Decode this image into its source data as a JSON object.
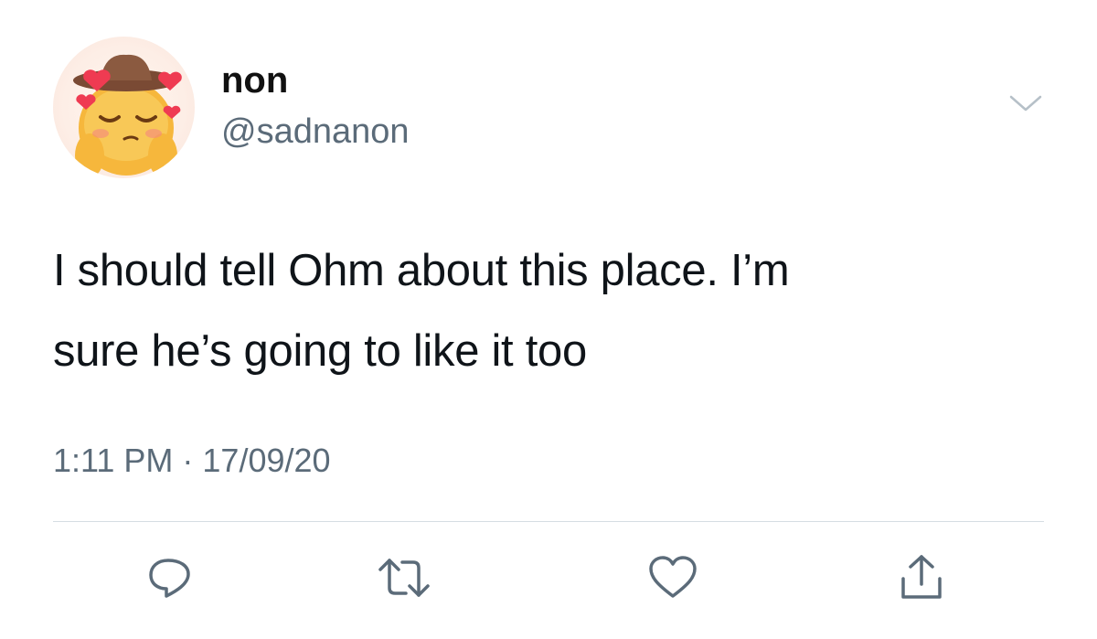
{
  "author": {
    "display_name": "non",
    "handle": "@sadnanon",
    "avatar_icon": "blushing-face-with-hearts-icon"
  },
  "tweet": {
    "text_line1": "I should tell Ohm about this place. I’m",
    "text_line2": "sure he’s going to like it too",
    "time": "1:11 PM",
    "separator": "·",
    "date": "17/09/20"
  },
  "actions": [
    {
      "name": "reply",
      "icon": "reply-bubble-icon"
    },
    {
      "name": "retweet",
      "icon": "retweet-icon"
    },
    {
      "name": "like",
      "icon": "heart-icon"
    },
    {
      "name": "share",
      "icon": "share-icon"
    }
  ],
  "colors": {
    "text_primary": "#0f1419",
    "text_secondary": "#5b6b79",
    "divider": "#d6dde3",
    "icon": "#5b6b79"
  }
}
